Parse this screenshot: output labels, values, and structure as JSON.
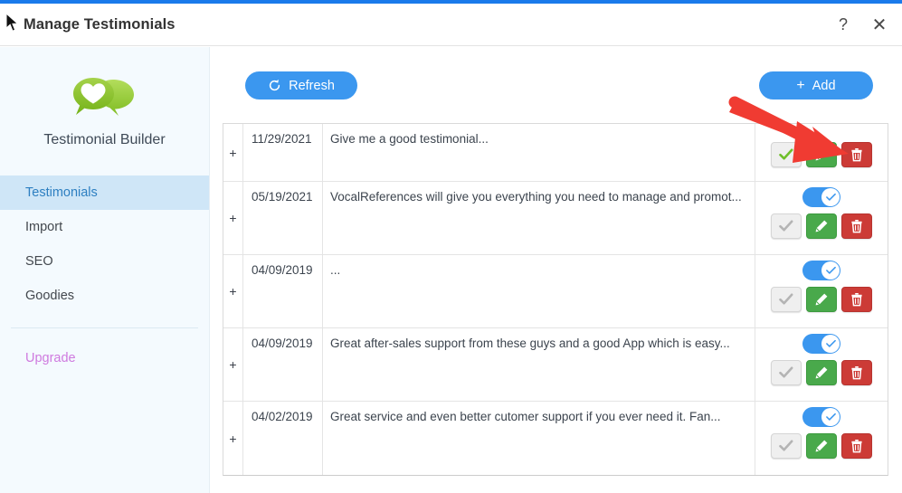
{
  "window": {
    "title": "Manage Testimonials",
    "help_label": "?",
    "close_label": "✕",
    "accent_color": "#1a7aeb"
  },
  "sidebar": {
    "brand": "Testimonial Builder",
    "logo_icon": "speech-bubbles-heart-icon",
    "logo_color": "#8dc63f",
    "items": [
      {
        "label": "Testimonials",
        "active": true
      },
      {
        "label": "Import",
        "active": false
      },
      {
        "label": "SEO",
        "active": false
      },
      {
        "label": "Goodies",
        "active": false
      }
    ],
    "upgrade": {
      "label": "Upgrade",
      "color": "#cf7adf"
    }
  },
  "toolbar": {
    "refresh_label": "Refresh",
    "refresh_icon": "refresh-circular-arrow-icon",
    "add_label": "Add",
    "add_icon": "plus-icon",
    "button_color": "#3b97ef"
  },
  "table": {
    "expand_glyph": "+",
    "rows": [
      {
        "date": "11/29/2021",
        "text": "Give me a good testimonial...",
        "has_toggle": false,
        "toggle_on": false,
        "approve_state": "active",
        "approve_icon": "check-icon",
        "edit_icon": "pencil-icon",
        "delete_icon": "trash-icon"
      },
      {
        "date": "05/19/2021",
        "text": "VocalReferences will give you everything you need to manage and promot...",
        "has_toggle": true,
        "toggle_on": true,
        "approve_state": "disabled",
        "approve_icon": "check-icon",
        "edit_icon": "pencil-icon",
        "delete_icon": "trash-icon"
      },
      {
        "date": "04/09/2019",
        "text": "...",
        "has_toggle": true,
        "toggle_on": true,
        "approve_state": "disabled",
        "approve_icon": "check-icon",
        "edit_icon": "pencil-icon",
        "delete_icon": "trash-icon"
      },
      {
        "date": "04/09/2019",
        "text": "Great after-sales support from these guys and a good App which is easy...",
        "has_toggle": true,
        "toggle_on": true,
        "approve_state": "disabled",
        "approve_icon": "check-icon",
        "edit_icon": "pencil-icon",
        "delete_icon": "trash-icon"
      },
      {
        "date": "04/02/2019",
        "text": "Great service and even better cutomer support if you ever need it. Fan...",
        "has_toggle": true,
        "toggle_on": true,
        "approve_state": "disabled",
        "approve_icon": "check-icon",
        "edit_icon": "pencil-icon",
        "delete_icon": "trash-icon"
      }
    ]
  },
  "annotation": {
    "arrow_color": "#f03b32",
    "points_to": "edit-button-row-1"
  }
}
